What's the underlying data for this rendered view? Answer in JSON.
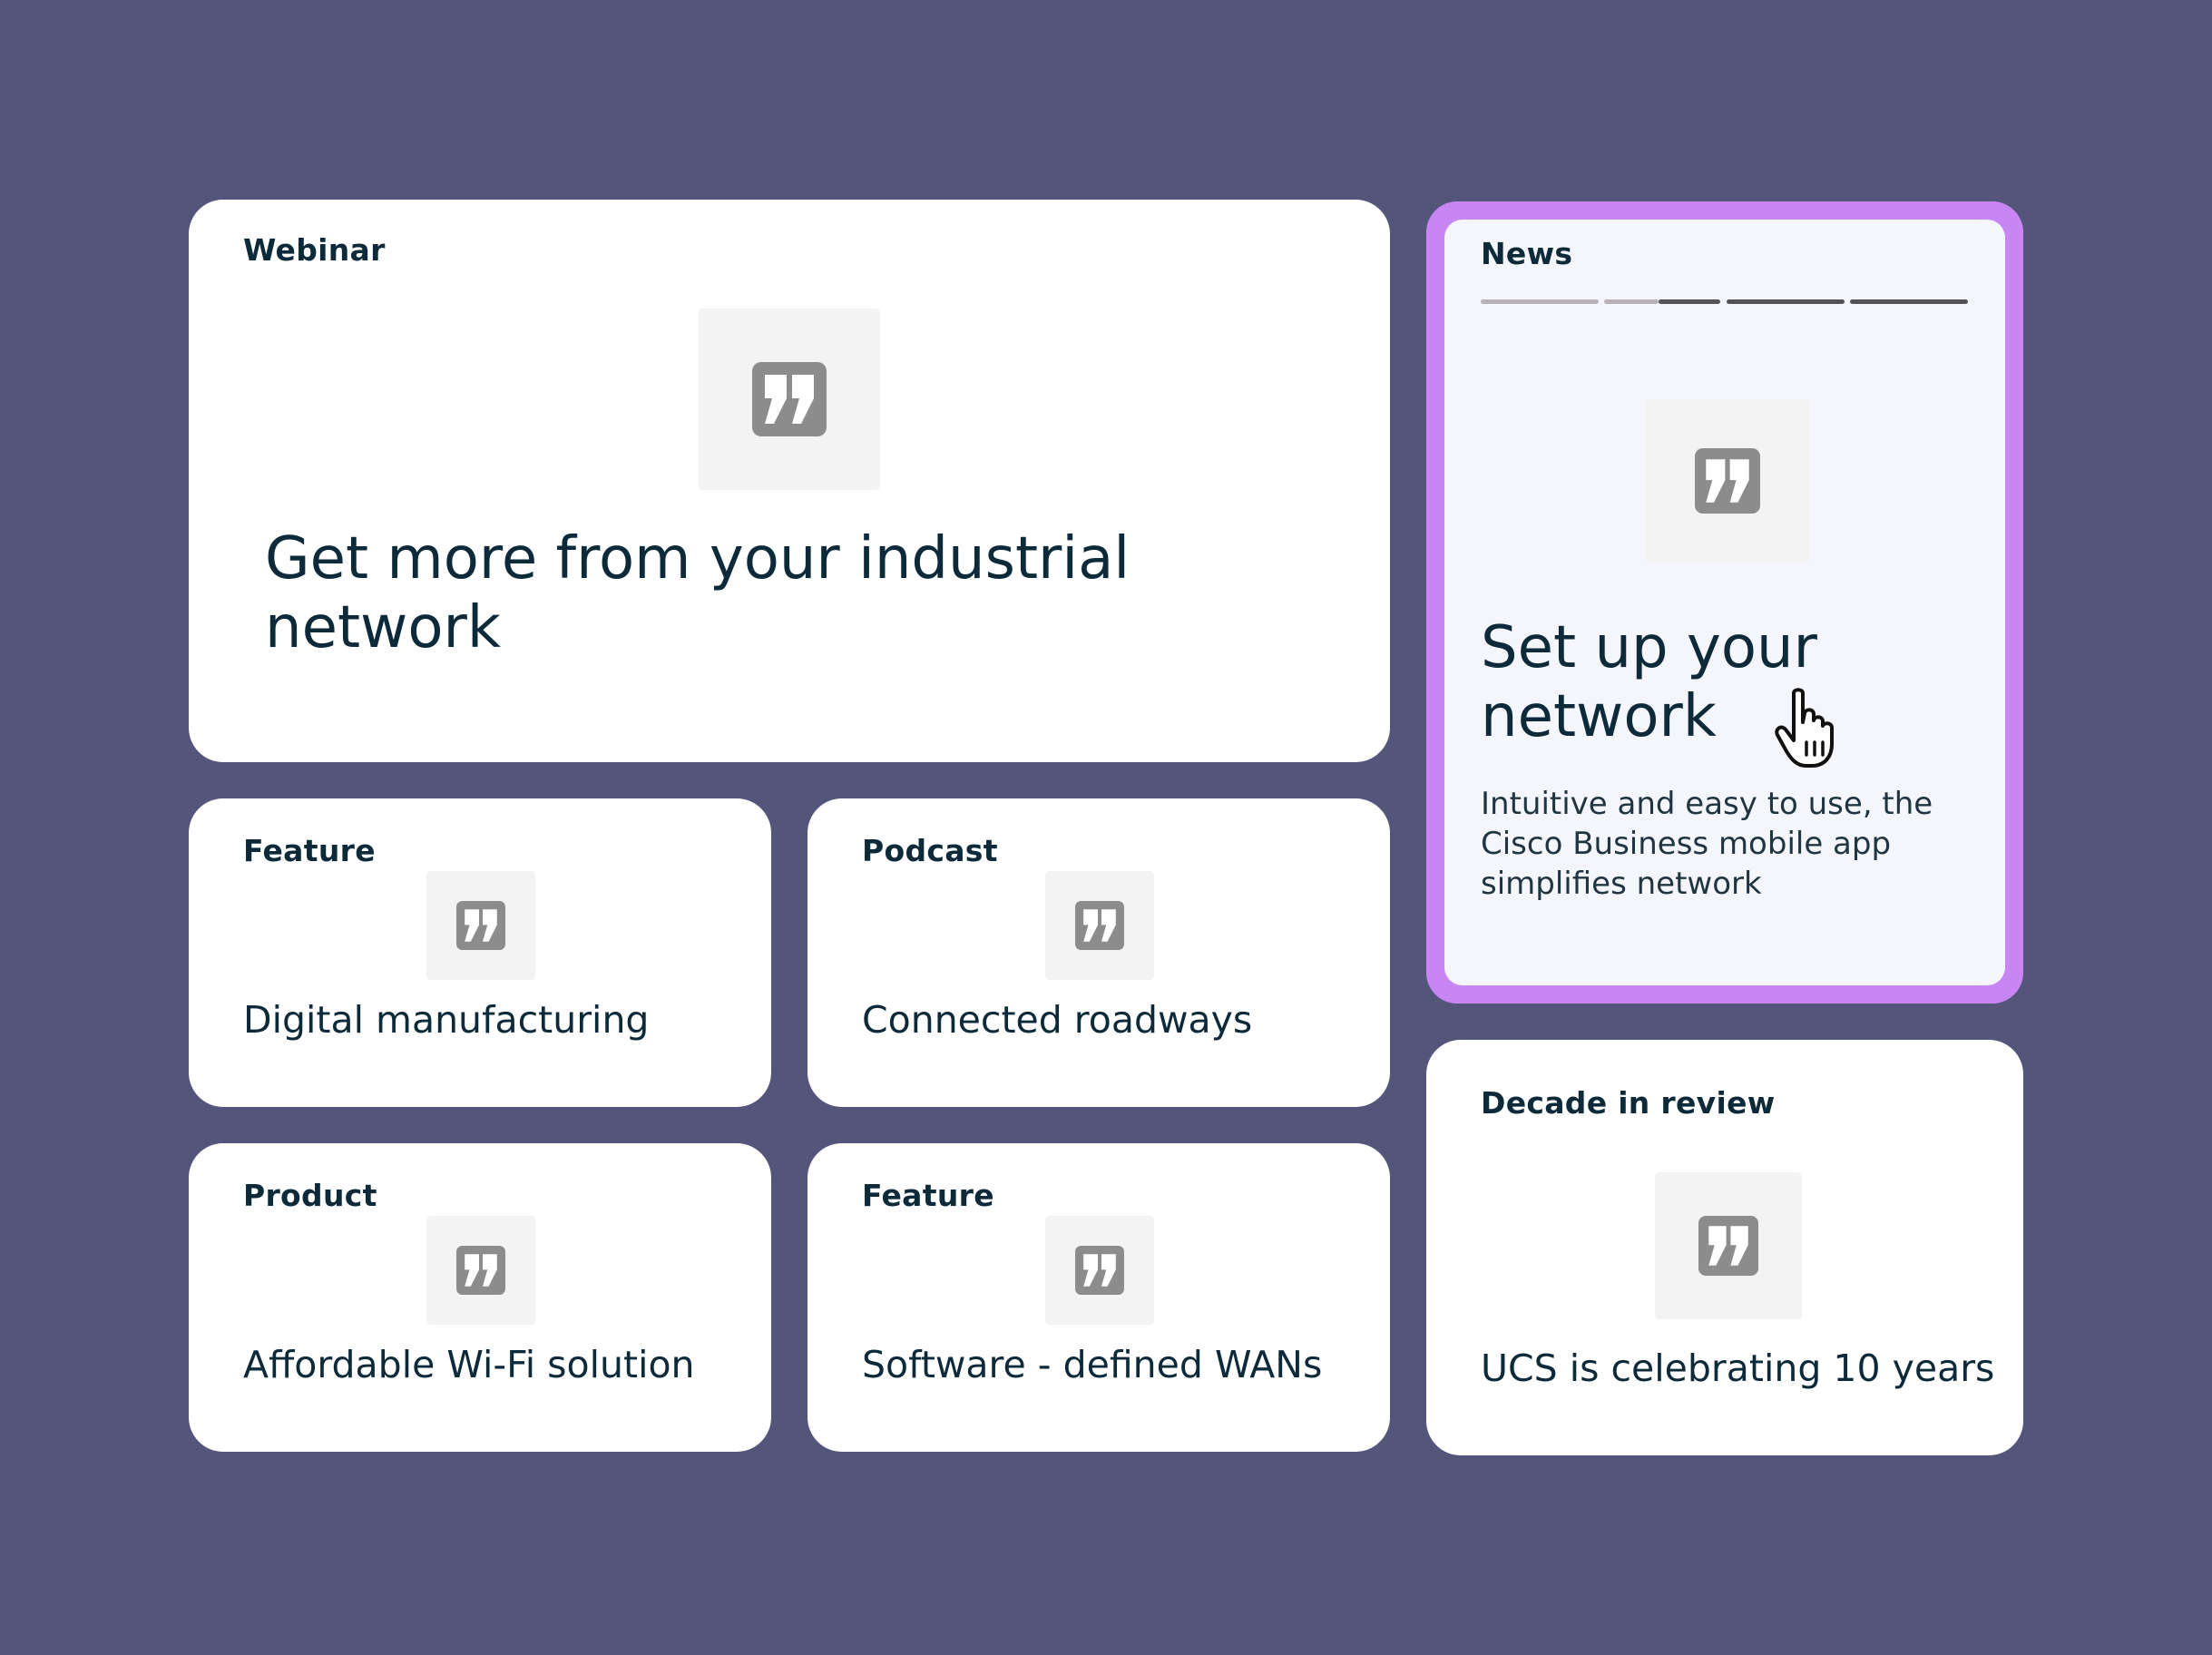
{
  "icon": "quote-icon",
  "colors": {
    "background": "#53557a",
    "card": "#ffffff",
    "highlight_border": "#c886f2",
    "text": "#0d2a3a"
  },
  "cards": {
    "webinar": {
      "tag": "Webinar",
      "title": "Get more from your industrial network"
    },
    "news": {
      "tag": "News",
      "title": "Set up your network",
      "description": "Intuitive and easy to use, the Cisco Business mobile app simplifies network",
      "progress_segments": 4,
      "progress_active": 1.5
    },
    "feature1": {
      "tag": "Feature",
      "title": "Digital manufacturing"
    },
    "podcast": {
      "tag": "Podcast",
      "title": "Connected roadways"
    },
    "product": {
      "tag": "Product",
      "title": "Affordable Wi-Fi solution"
    },
    "feature2": {
      "tag": "Feature",
      "title": "Software - defined WANs"
    },
    "decade": {
      "tag": "Decade in review",
      "title": "UCS is celebrating 10 years"
    }
  }
}
